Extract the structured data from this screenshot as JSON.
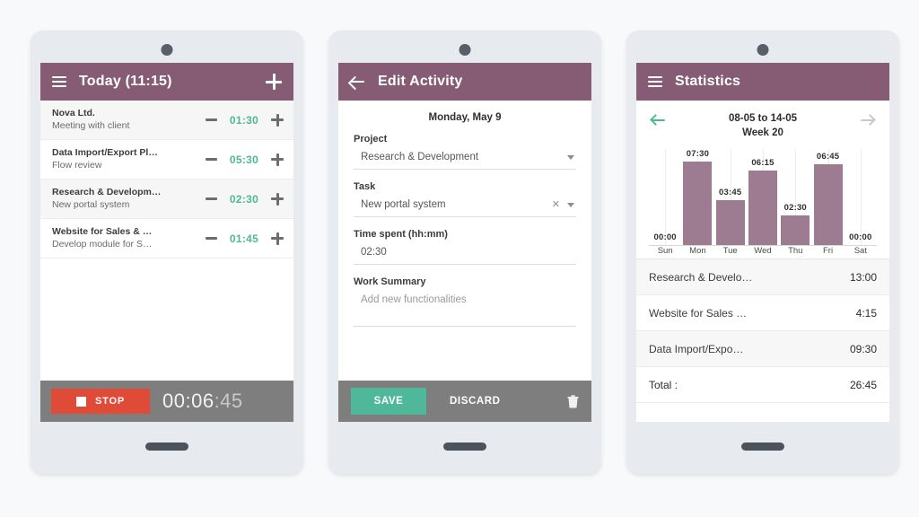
{
  "phones": {
    "today": {
      "appbar": {
        "menu_icon": "hamburger-icon",
        "title": "Today (11:15)",
        "add_icon": "plus-icon"
      },
      "activities": [
        {
          "project": "Nova Ltd.",
          "task": "Meeting with client",
          "time": "01:30"
        },
        {
          "project": "Data Import/Export Pl…",
          "task": "Flow review",
          "time": "05:30"
        },
        {
          "project": "Research & Developm…",
          "task": "New portal system",
          "time": "02:30"
        },
        {
          "project": "Website for Sales & …",
          "task": "Develop module for S…",
          "time": "01:45"
        }
      ],
      "footer": {
        "stop_label": "STOP",
        "timer_main": "00:06",
        "timer_seconds": ":45",
        "stop_icon": "stop-square-icon"
      }
    },
    "edit": {
      "appbar": {
        "back_icon": "back-arrow-icon",
        "title": "Edit Activity"
      },
      "date": "Monday, May 9",
      "fields": {
        "project_label": "Project",
        "project_value": "Research & Development",
        "task_label": "Task",
        "task_value": "New portal system",
        "time_label": "Time spent (hh:mm)",
        "time_value": "02:30",
        "summary_label": "Work Summary",
        "summary_value": "Add new functionalities"
      },
      "footer": {
        "save_label": "SAVE",
        "discard_label": "DISCARD",
        "delete_icon": "trash-icon"
      }
    },
    "statistics": {
      "appbar": {
        "menu_icon": "hamburger-icon",
        "title": "Statistics"
      },
      "week_nav": {
        "prev_icon": "arrow-left-icon",
        "next_icon": "arrow-right-icon",
        "range": "08-05 to 14-05",
        "week": "Week 20"
      },
      "summary_rows": [
        {
          "name": "Research & Develo…",
          "value": "13:00"
        },
        {
          "name": "Website for Sales …",
          "value": "4:15"
        },
        {
          "name": "Data Import/Expo…",
          "value": "09:30"
        },
        {
          "name": "Total :",
          "value": "26:45"
        }
      ]
    }
  },
  "chart_data": {
    "type": "bar",
    "title": "Week 20",
    "subtitle": "08-05 to 14-05",
    "xlabel": "",
    "ylabel": "",
    "categories": [
      "Sun",
      "Mon",
      "Tue",
      "Wed",
      "Thu",
      "Fri",
      "Sat"
    ],
    "labels": [
      "00:00",
      "07:30",
      "03:45",
      "06:15",
      "02:30",
      "06:45",
      "00:00"
    ],
    "values": [
      0,
      7.5,
      3.75,
      6.25,
      2.5,
      6.75,
      0
    ],
    "ylim": [
      0,
      8
    ],
    "grid": true,
    "legend": false,
    "bar_color": "#9d7c92"
  },
  "colors": {
    "appbar_purple": "#865c74",
    "bar_purple": "#9d7c92",
    "accent_green": "#4db997",
    "stop_red": "#e04b37",
    "footer_gray": "#7e7e7e",
    "page_bg": "#f8f9fa",
    "phone_body": "#e7eaee"
  }
}
